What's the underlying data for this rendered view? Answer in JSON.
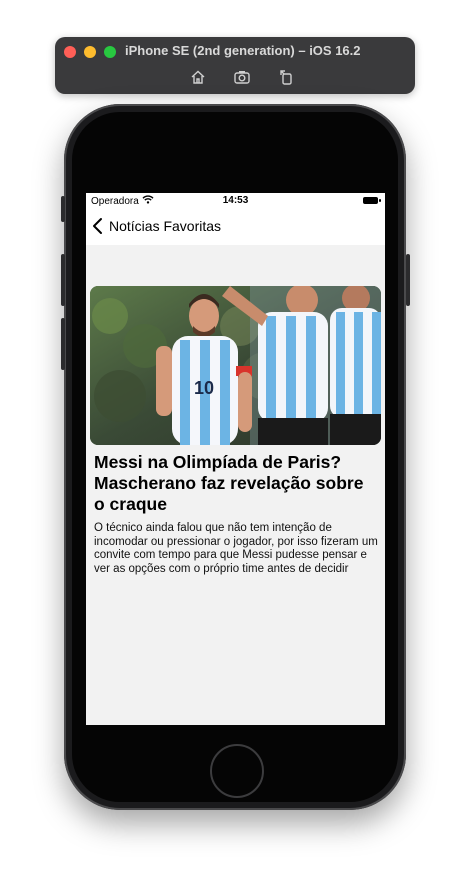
{
  "simulator": {
    "title": "iPhone SE (2nd generation) – iOS 16.2",
    "tools": [
      "home-icon",
      "screenshot-icon",
      "rotate-icon"
    ]
  },
  "status_bar": {
    "carrier": "Operadora",
    "time": "14:53"
  },
  "nav": {
    "back_label": "Notícias Favoritas"
  },
  "article": {
    "headline": "Messi na Olimpíada de Paris? Mascherano faz revelação sobre o craque",
    "summary": "O técnico ainda falou que não tem intenção de incomodar ou pressionar o jogador, por isso fizeram um convite com tempo para que Messi pudesse pensar e ver as opções com o próprio time antes de decidir",
    "image": "football-players-photo",
    "jersey_number": "10"
  },
  "colors": {
    "background": "#f2f2f2",
    "jersey_blue": "#6cb4e4",
    "captain_band": "#d9342b"
  }
}
